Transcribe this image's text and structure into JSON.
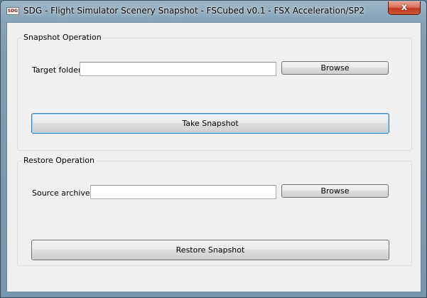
{
  "window": {
    "icon_text": "SDG",
    "title": "SDG - Flight Simulator Scenery Snapshot - FSCubed v0.1 - FSX Acceleration/SP2",
    "close_glyph": "x"
  },
  "snapshot": {
    "group_title": "Snapshot Operation",
    "target_label": "Target folder",
    "target_value": "",
    "browse_label": "Browse",
    "action_label": "Take Snapshot"
  },
  "restore": {
    "group_title": "Restore Operation",
    "source_label": "Source archive",
    "source_value": "",
    "browse_label": "Browse",
    "action_label": "Restore Snapshot"
  }
}
